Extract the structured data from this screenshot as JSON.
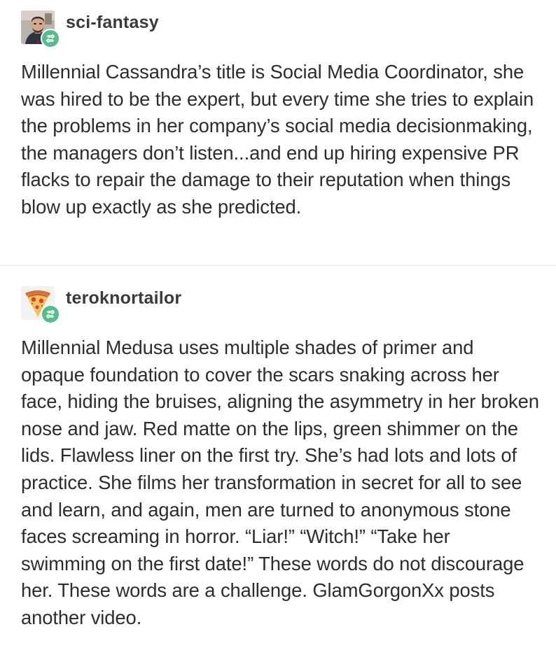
{
  "posts": [
    {
      "username": "sci-fantasy",
      "avatar_icon": "bearded-man-avatar",
      "badge_icon": "reblog-icon",
      "text": "Millennial Cassandra’s title is Social Media Coordinator, she was hired to be the expert, but every time she tries to explain the problems in her company’s social media decisionmaking, the managers don’t listen...and end up hiring expensive PR flacks to repair the damage to their reputation when things blow up exactly as she predicted."
    },
    {
      "username": "teroknortailor",
      "avatar_icon": "pizza-slice-avatar",
      "badge_icon": "reblog-icon",
      "text": "Millennial Medusa uses multiple shades of primer and opaque foundation to cover the scars snaking across her face, hiding the bruises, aligning the asymmetry in her broken nose and jaw. Red matte on the lips, green shimmer on the lids. Flawless liner on the first try. She’s had lots and lots of practice. She films her transformation in secret for all to see and learn, and again, men are turned to anonymous stone faces screaming in horror. “Liar!” “Witch!” “Take her swimming on the first date!” These words do not discourage her. These words are a challenge. GlamGorgonXx posts another video."
    }
  ],
  "colors": {
    "reblog_badge": "#56bc8a",
    "text": "#2d2d2d",
    "divider": "#e8e8e8"
  }
}
